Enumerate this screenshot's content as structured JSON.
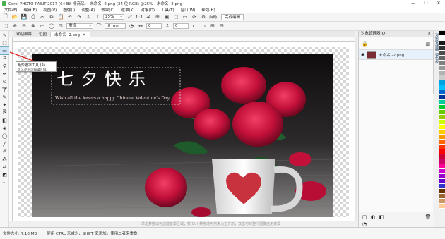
{
  "window": {
    "title": "Corel PHOTO-PAINT 2017 (64-Bit 非商品) - 未命名 -2.png (24 位 RGB) @25% - 未命名 -2.png",
    "controls": [
      "—",
      "☐",
      "✕"
    ]
  },
  "menu": [
    "文件(F)",
    "编辑(E)",
    "视图(V)",
    "图像(I)",
    "调整(A)",
    "效果(C)",
    "遮罩(K)",
    "对象(O)",
    "工具(T)",
    "窗口(W)",
    "帮助(H)"
  ],
  "toolbar": {
    "zoom": "25%",
    "launch_label": "启动",
    "complete_edit": "完成编辑"
  },
  "propbar": {
    "mode": "常规",
    "feather": ".0 mm",
    "value1": "0",
    "value2": "0"
  },
  "tabs": [
    {
      "label": "欢迎屏幕",
      "active": false
    },
    {
      "label": "位图",
      "active": false
    },
    {
      "label": "未命名 -2.png",
      "active": true
    }
  ],
  "tooltip": {
    "title": "矩形遮罩工具 (R)",
    "desc": "定义矩形可编辑区域。"
  },
  "photo_text": {
    "chinese": "七夕快乐",
    "english": "Wish all the lovers a happy Chinese Valentine's Day"
  },
  "canvas_hint": "单击并拖动可创建遮罩区域；按 Ctrl 并拖动可约束为正方形；双击可对整个图像应用遮罩",
  "object_manager": {
    "title": "对象管理器(O)",
    "layer_name": "未命名 -2.png"
  },
  "side_tabs": [
    "对象管理器",
    "调色板"
  ],
  "status": {
    "file_size": "文件大小: 7.18 MB",
    "hint": "使用 CTRL 来减少，SHIFT 来添加，使用二者来重叠"
  },
  "palette": [
    "#000000",
    "#ffffff",
    "#1a1a1a",
    "#333333",
    "#4d4d4d",
    "#666666",
    "#808080",
    "#999999",
    "#b3b3b3",
    "#cccccc",
    "#00a3e0",
    "#00bfff",
    "#0066cc",
    "#003399",
    "#00cc99",
    "#00cc33",
    "#66cc00",
    "#99cc00",
    "#ccff00",
    "#ffff00",
    "#ffcc00",
    "#ff9900",
    "#ff6600",
    "#ff3300",
    "#ff0000",
    "#cc0033",
    "#cc0066",
    "#ff0099",
    "#cc00cc",
    "#9900cc",
    "#6600cc",
    "#3333cc",
    "#663300",
    "#996633",
    "#cc9966",
    "#ffcc99"
  ]
}
